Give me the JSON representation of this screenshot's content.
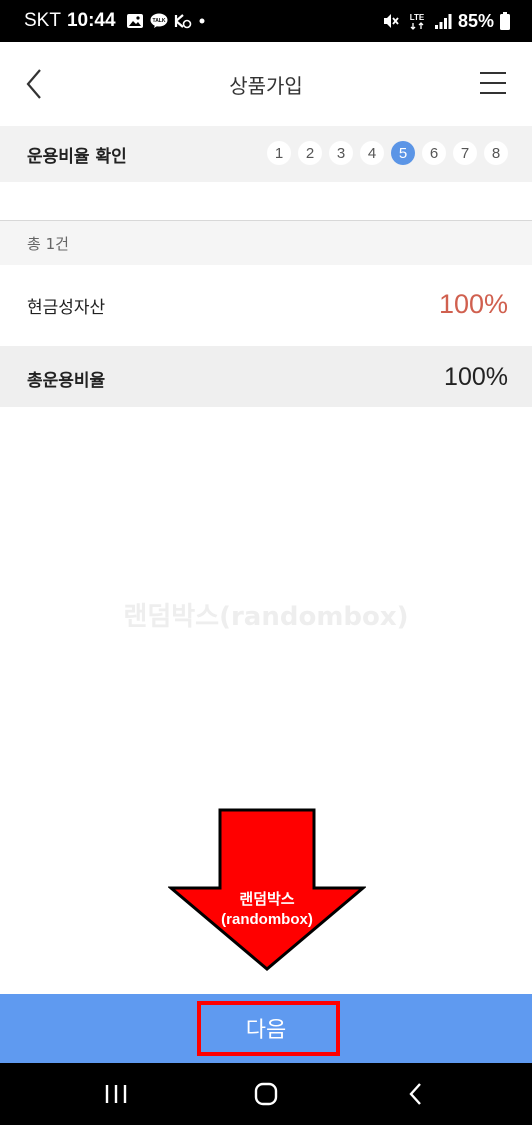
{
  "status_bar": {
    "carrier": "SKT",
    "time": "10:44",
    "battery": "85%",
    "icons_left": [
      "image-icon",
      "talk-icon",
      "key-icon",
      "dot-icon"
    ],
    "icons_right": [
      "mute-icon",
      "lte-icon",
      "signal-icon",
      "battery-icon"
    ]
  },
  "header": {
    "title": "상품가입",
    "back_icon": "chevron-left-icon",
    "menu_icon": "hamburger-menu-icon"
  },
  "step_bar": {
    "label": "운용비율 확인",
    "steps": [
      "1",
      "2",
      "3",
      "4",
      "5",
      "6",
      "7",
      "8"
    ],
    "active_step": "5"
  },
  "summary": {
    "count_text": "총 1건"
  },
  "allocation": {
    "asset_label": "현금성자산",
    "asset_value": "100%",
    "total_label": "총운용비율",
    "total_value": "100%"
  },
  "watermark": "랜덤박스(randombox)",
  "overlay": {
    "line1": "랜덤박스",
    "line2": "(randombox)",
    "arrow_color": "#ff0000"
  },
  "footer": {
    "next_label": "다음"
  },
  "nav_bar": {
    "icons": [
      "recent-apps-icon",
      "home-icon",
      "back-icon"
    ]
  },
  "colors": {
    "accent": "#5b95e6",
    "button": "#5f9af0",
    "value_red": "#d0604f"
  }
}
